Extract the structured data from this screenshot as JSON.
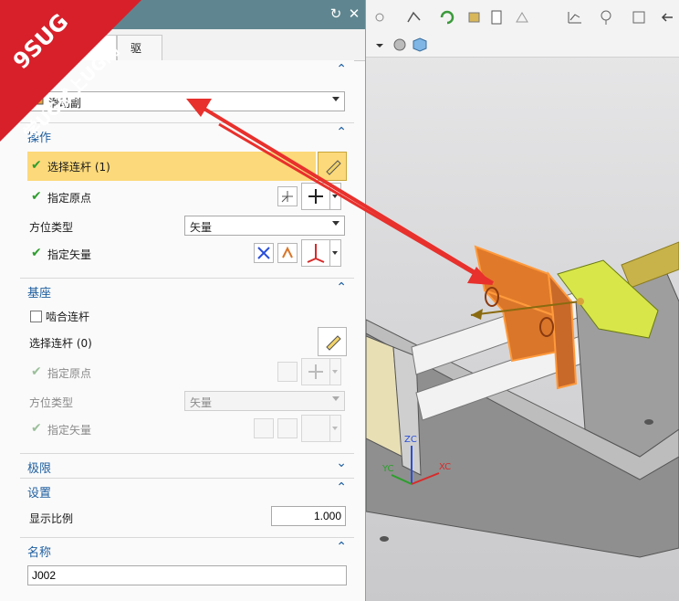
{
  "dialog": {
    "tabs": [
      "",
      "驱动"
    ],
    "type_value": "滑动副",
    "operation": {
      "title": "操作",
      "select_link": "选择连杆 (1)",
      "origin": "指定原点",
      "orient_type_label": "方位类型",
      "orient_type_value": "矢量",
      "vector": "指定矢量"
    },
    "base": {
      "title": "基座",
      "snap_link": "啮合连杆",
      "select_link": "选择连杆 (0)",
      "origin": "指定原点",
      "orient_type_label": "方位类型",
      "orient_type_value": "矢量",
      "vector": "指定矢量"
    },
    "limits": {
      "title": "极限"
    },
    "settings": {
      "title": "设置",
      "scale_label": "显示比例",
      "scale_value": "1.000"
    },
    "name": {
      "title": "名称",
      "value": "J002"
    }
  },
  "viewport": {
    "triad": {
      "x": "XC",
      "y": "YC",
      "z": "ZC"
    }
  },
  "watermark": {
    "line1": "9SUG",
    "line2": "学UG就上UG网"
  },
  "colors": {
    "titlebar": "#5f8690",
    "accent": "#1f5fa0",
    "highlight": "#fcd97a",
    "arrow": "#e8302c"
  }
}
